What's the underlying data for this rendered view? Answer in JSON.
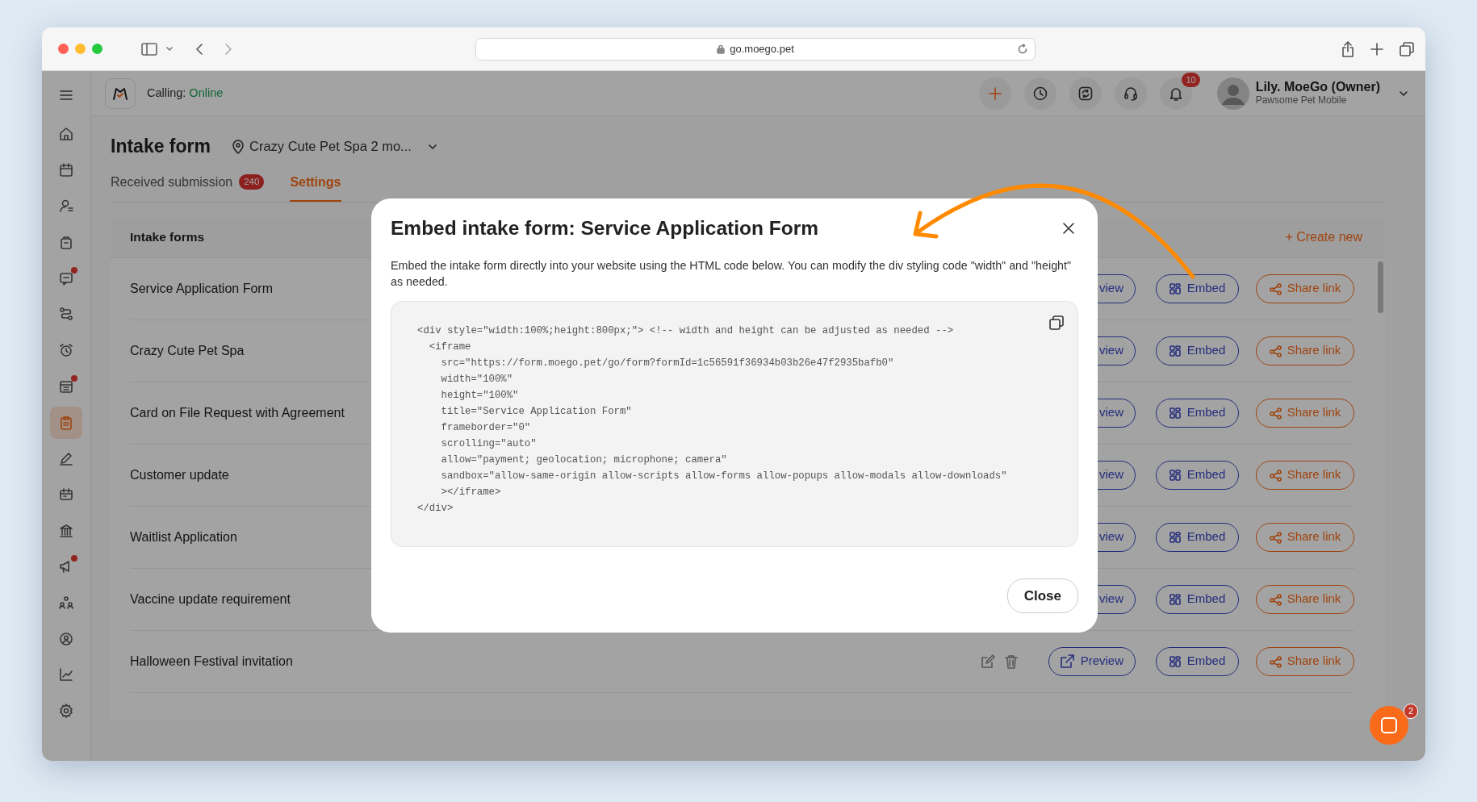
{
  "browser": {
    "url": "go.moego.pet"
  },
  "app_header": {
    "calling_label": "Calling:",
    "calling_status": "Online",
    "notifications": "10",
    "user": {
      "name": "Lily. MoeGo (Owner)",
      "business": "Pawsome Pet Mobile"
    }
  },
  "sidebar": {
    "items": [
      {
        "selected": false,
        "alert": false
      },
      {
        "selected": false,
        "alert": false
      },
      {
        "selected": false,
        "alert": false
      },
      {
        "selected": false,
        "alert": false
      },
      {
        "selected": false,
        "alert": true
      },
      {
        "selected": false,
        "alert": false
      },
      {
        "selected": false,
        "alert": false
      },
      {
        "selected": false,
        "alert": true
      },
      {
        "selected": true,
        "alert": false
      },
      {
        "selected": false,
        "alert": false
      },
      {
        "selected": false,
        "alert": false
      },
      {
        "selected": false,
        "alert": false
      },
      {
        "selected": false,
        "alert": true
      },
      {
        "selected": false,
        "alert": false
      },
      {
        "selected": false,
        "alert": false
      },
      {
        "selected": false,
        "alert": false
      },
      {
        "selected": false,
        "alert": false
      }
    ]
  },
  "page": {
    "title": "Intake form",
    "location": "Crazy Cute Pet Spa 2 mo...",
    "tabs": [
      {
        "label": "Received submission",
        "badge": "240",
        "selected": false
      },
      {
        "label": "Settings",
        "selected": true
      }
    ]
  },
  "forms_card": {
    "title": "Intake forms",
    "create_label": "+ Create new",
    "rows": [
      {
        "name": "Service Application Form",
        "preview_label": "view",
        "embed_label": "Embed",
        "share_label": "Share link"
      },
      {
        "name": "Crazy Cute Pet Spa",
        "preview_label": "view",
        "embed_label": "Embed",
        "share_label": "Share link"
      },
      {
        "name": "Card on File Request with Agreement",
        "preview_label": "view",
        "embed_label": "Embed",
        "share_label": "Share link"
      },
      {
        "name": "Customer update",
        "preview_label": "view",
        "embed_label": "Embed",
        "share_label": "Share link"
      },
      {
        "name": "Waitlist Application",
        "preview_label": "view",
        "embed_label": "Embed",
        "share_label": "Share link"
      },
      {
        "name": "Vaccine update requirement",
        "preview_label": "view",
        "embed_label": "Embed",
        "share_label": "Share link"
      },
      {
        "name": "Halloween Festival invitation",
        "preview_label": "Preview",
        "embed_label": "Embed",
        "share_label": "Share link"
      }
    ]
  },
  "modal": {
    "title": "Embed intake form: Service Application Form",
    "description": "Embed the intake form directly into your website using the HTML code below. You can modify the div styling code \"width\" and \"height\" as needed.",
    "code": "<div style=\"width:100%;height:800px;\"> <!-- width and height can be adjusted as needed -->\n  <iframe\n    src=\"https://form.moego.pet/go/form?formId=1c56591f36934b03b26e47f2935bafb0\"\n    width=\"100%\"\n    height=\"100%\"\n    title=\"Service Application Form\"\n    frameborder=\"0\"\n    scrolling=\"auto\"\n    allow=\"payment; geolocation; microphone; camera\"\n    sandbox=\"allow-same-origin allow-scripts allow-forms allow-popups allow-modals allow-downloads\"\n    ></iframe>\n</div>",
    "close_label": "Close"
  },
  "chat": {
    "badge": "2"
  }
}
